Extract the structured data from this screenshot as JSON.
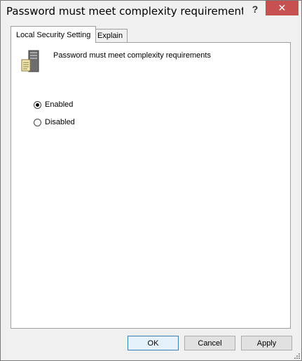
{
  "window": {
    "title": "Password must meet complexity requirements Pro...",
    "help_label": "?",
    "close_label": "✕"
  },
  "tabs": [
    {
      "label": "Local Security Setting",
      "active": true
    },
    {
      "label": "Explain",
      "active": false
    }
  ],
  "policy": {
    "name": "Password must meet complexity requirements",
    "icon": "server-policy-icon"
  },
  "options": [
    {
      "label": "Enabled",
      "checked": true
    },
    {
      "label": "Disabled",
      "checked": false
    }
  ],
  "buttons": {
    "ok": "OK",
    "cancel": "Cancel",
    "apply": "Apply"
  },
  "colors": {
    "close_button": "#c75050",
    "default_button_border": "#3c7fb1"
  }
}
